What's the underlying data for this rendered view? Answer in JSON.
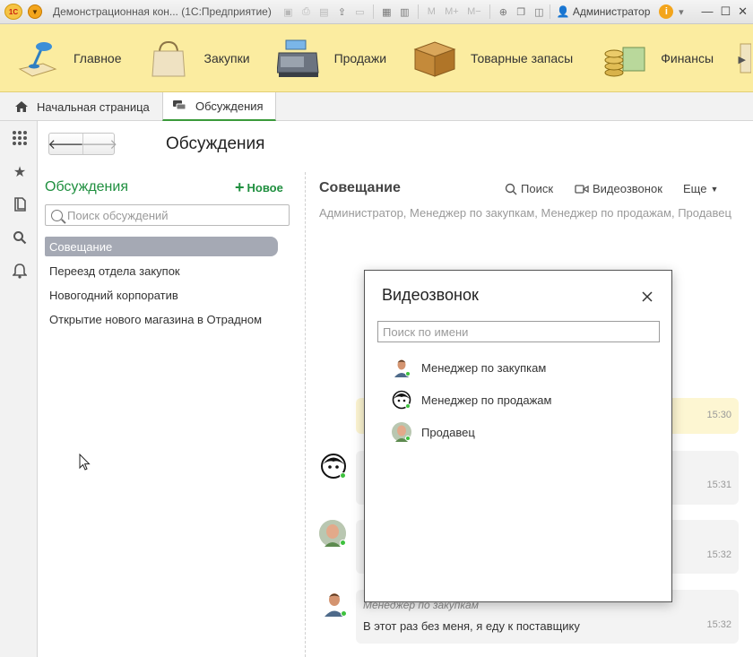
{
  "window": {
    "logo": "1С",
    "title": "Демонстрационная кон... (1С:Предприятие)",
    "user": "Администратор"
  },
  "sections": [
    {
      "label": "Главное"
    },
    {
      "label": "Закупки"
    },
    {
      "label": "Продажи"
    },
    {
      "label": "Товарные запасы"
    },
    {
      "label": "Финансы"
    }
  ],
  "tabs": [
    {
      "label": "Начальная страница"
    },
    {
      "label": "Обсуждения"
    }
  ],
  "page": {
    "title": "Обсуждения"
  },
  "discussions": {
    "header": "Обсуждения",
    "new_label": "Новое",
    "search_placeholder": "Поиск обсуждений",
    "items": [
      {
        "label": "Совещание",
        "selected": true
      },
      {
        "label": "Переезд отдела закупок"
      },
      {
        "label": "Новогодний корпоратив"
      },
      {
        "label": "Открытие нового магазина в Отрадном"
      }
    ]
  },
  "conversation": {
    "title": "Совещание",
    "search_label": "Поиск",
    "video_label": "Видеозвонок",
    "more_label": "Еще",
    "members": "Администратор, Менеджер по закупкам, Менеджер по продажам, Продавец",
    "messages": [
      {
        "time": "15:30"
      },
      {
        "time": "15:31"
      },
      {
        "time": "15:32"
      },
      {
        "author": "Менеджер по закупкам",
        "text": "В этот раз без меня, я еду к поставщику",
        "time": "15:32"
      }
    ]
  },
  "video_dialog": {
    "title": "Видеозвонок",
    "search_placeholder": "Поиск по имени",
    "contacts": [
      {
        "name": "Менеджер по закупкам"
      },
      {
        "name": "Менеджер по продажам"
      },
      {
        "name": "Продавец"
      }
    ]
  },
  "colors": {
    "accent_green": "#1f8f3f",
    "sections_bg": "#fbeca0",
    "selected_item": "#a5a9b4",
    "online": "#3ec13e"
  }
}
